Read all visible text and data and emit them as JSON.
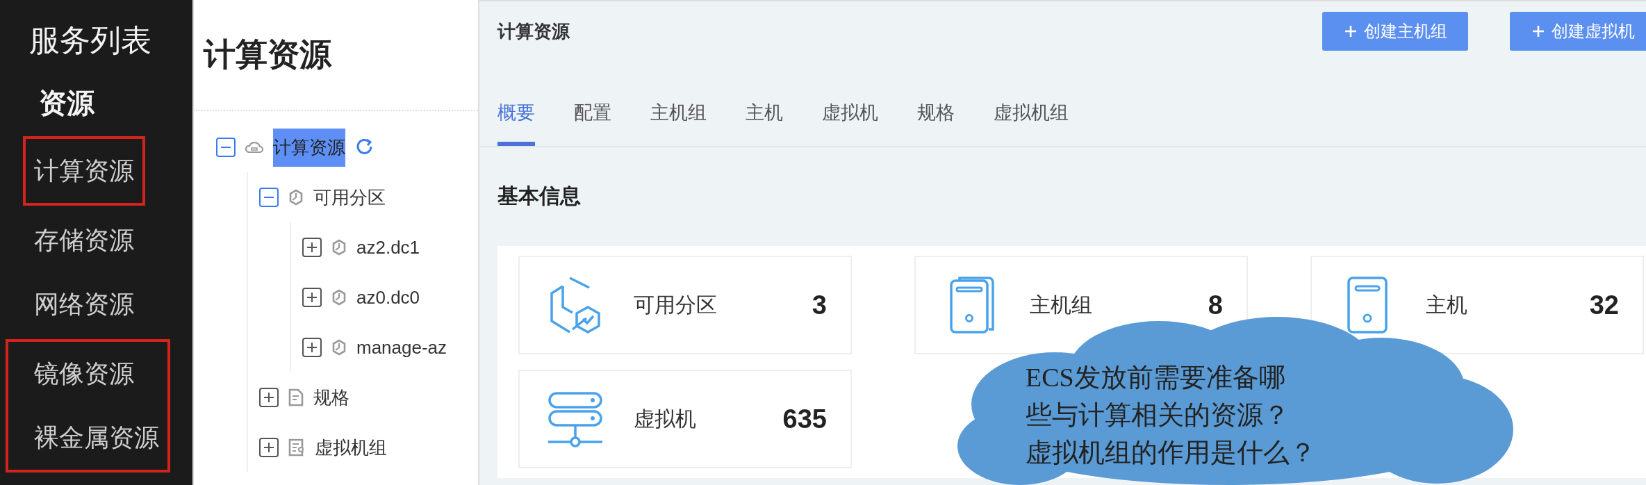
{
  "sidebar": {
    "title": "服务列表",
    "section": "资源",
    "groups": [
      {
        "highlighted": true,
        "items": [
          "计算资源"
        ]
      },
      {
        "highlighted": false,
        "items": [
          "存储资源",
          "网络资源"
        ]
      },
      {
        "highlighted": true,
        "items": [
          "镜像资源",
          "裸金属资源"
        ]
      }
    ]
  },
  "tree_panel": {
    "title": "计算资源",
    "tree": [
      {
        "label": "计算资源",
        "kind": "root",
        "expanded": true,
        "selected": true,
        "children": [
          {
            "label": "可用分区",
            "kind": "zone",
            "expanded": true,
            "selected": false,
            "children": [
              {
                "label": "az2.dc1",
                "kind": "zone",
                "expanded": false,
                "selected": false
              },
              {
                "label": "az0.dc0",
                "kind": "zone",
                "expanded": false,
                "selected": false
              },
              {
                "label": "manage-az",
                "kind": "zone",
                "expanded": false,
                "selected": false
              }
            ]
          },
          {
            "label": "规格",
            "kind": "spec",
            "expanded": false,
            "selected": false
          },
          {
            "label": "虚拟机组",
            "kind": "group",
            "expanded": false,
            "selected": false
          }
        ]
      }
    ]
  },
  "main": {
    "title": "计算资源",
    "buttons": [
      "创建主机组",
      "创建虚拟机"
    ],
    "tabs": [
      {
        "label": "概要",
        "selected": true
      },
      {
        "label": "配置",
        "selected": false
      },
      {
        "label": "主机组",
        "selected": false
      },
      {
        "label": "主机",
        "selected": false
      },
      {
        "label": "虚拟机",
        "selected": false
      },
      {
        "label": "规格",
        "selected": false
      },
      {
        "label": "虚拟机组",
        "selected": false
      }
    ],
    "section_title": "基本信息",
    "stats": [
      {
        "kind": "zone",
        "label": "可用分区",
        "value": "3"
      },
      {
        "kind": "hostgroup",
        "label": "主机组",
        "value": "8"
      },
      {
        "kind": "host",
        "label": "主机",
        "value": "32"
      },
      {
        "kind": "vm",
        "label": "虚拟机",
        "value": "635"
      }
    ]
  },
  "callout": {
    "lines": [
      "ECS发放前需要准备哪",
      "些与计算相关的资源？",
      "虚拟机组的作用是什么？"
    ]
  }
}
